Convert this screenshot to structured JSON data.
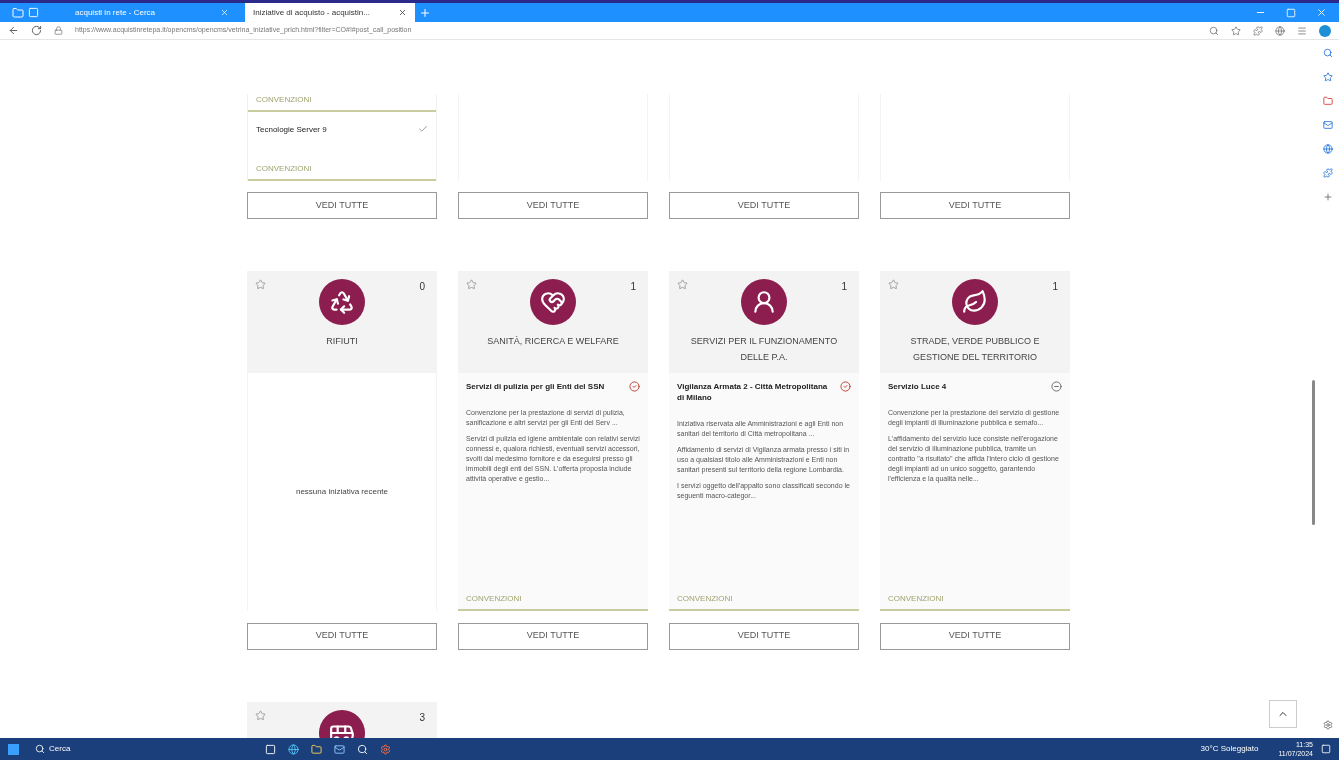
{
  "browser": {
    "tabs": [
      {
        "label": "acquisti in rete - Cerca",
        "selected": false
      },
      {
        "label": "Iniziative di acquisto - acquistin...",
        "selected": true
      }
    ],
    "url": "https://www.acquistinretepa.it/opencms/opencms/vetrina_iniziative_prich.html?filter=CO#!#post_call_position"
  },
  "top_row": [
    {
      "tag_top": "CONVENZIONI",
      "item": {
        "title": "Tecnologie Server 9"
      },
      "tag_bottom": "CONVENZIONI",
      "button": "VEDI TUTTE"
    },
    {
      "button": "VEDI TUTTE"
    },
    {
      "button": "VEDI TUTTE"
    },
    {
      "button": "VEDI TUTTE"
    }
  ],
  "categories": [
    {
      "title": "RIFIUTI",
      "count": "0",
      "favorite": false,
      "empty_text": "nessuna iniziativa recente",
      "button": "VEDI TUTTE"
    },
    {
      "title": "SANITÀ, RICERCA E WELFARE",
      "count": "1",
      "favorite": false,
      "item": {
        "title": "Servizi di pulizia per gli Enti del SSN",
        "active": true,
        "paragraphs": [
          "Convenzione per la prestazione di servizi di pulizia, sanificazione e altri servizi per gli Enti del Serv ...",
          "Servizi di pulizia ed igiene ambientale con relativi servizi connessi e, qualora richiesti, eventuali servizi accessori, svolti dal medesimo fornitore e da eseguirsi presso gli immobili degli enti del SSN. L'offerta proposta include attività operative e gestio..."
        ],
        "tag": "CONVENZIONI"
      },
      "button": "VEDI TUTTE"
    },
    {
      "title": "SERVIZI PER IL FUNZIONAMENTO DELLE P.A.",
      "count": "1",
      "favorite": false,
      "item": {
        "title": "Vigilanza Armata 2 - Città Metropolitana di Milano",
        "active": true,
        "paragraphs": [
          "Iniziativa riservata alle Amministrazioni e agli Enti non sanitari del territorio di Città metropolitana ...",
          "Affidamento di servizi di Vigilanza armata presso i siti in uso a qualsiasi titolo alle Amministrazioni e Enti non sanitari presenti sul territorio della regione Lombardia.",
          "I servizi oggetto dell'appalto sono classificati secondo le seguenti macro-categor..."
        ],
        "tag": "CONVENZIONI"
      },
      "button": "VEDI TUTTE"
    },
    {
      "title": "STRADE, VERDE PUBBLICO E GESTIONE DEL TERRITORIO",
      "count": "1",
      "favorite": false,
      "item": {
        "title": "Servizio Luce 4",
        "active": false,
        "paragraphs": [
          "Convenzione per la prestazione del servizio di gestione degli impianti di illuminazione pubblica e semafo...",
          "L'affidamento del servizio luce consiste nell'erogazione del servizio di illuminazione pubblica, tramite un contratto \"a risultato\" che affida l'intero ciclo di gestione degli impianti ad un unico soggetto, garantendo l'efficienza e la qualità nelle..."
        ],
        "tag": "CONVENZIONI"
      },
      "button": "VEDI TUTTE"
    }
  ],
  "next_row": [
    {
      "count": "3",
      "favorite": false
    }
  ],
  "taskbar": {
    "search": "Cerca",
    "weather": "30°C Soleggiato",
    "time": "11:35",
    "date": "11/07/2024"
  }
}
